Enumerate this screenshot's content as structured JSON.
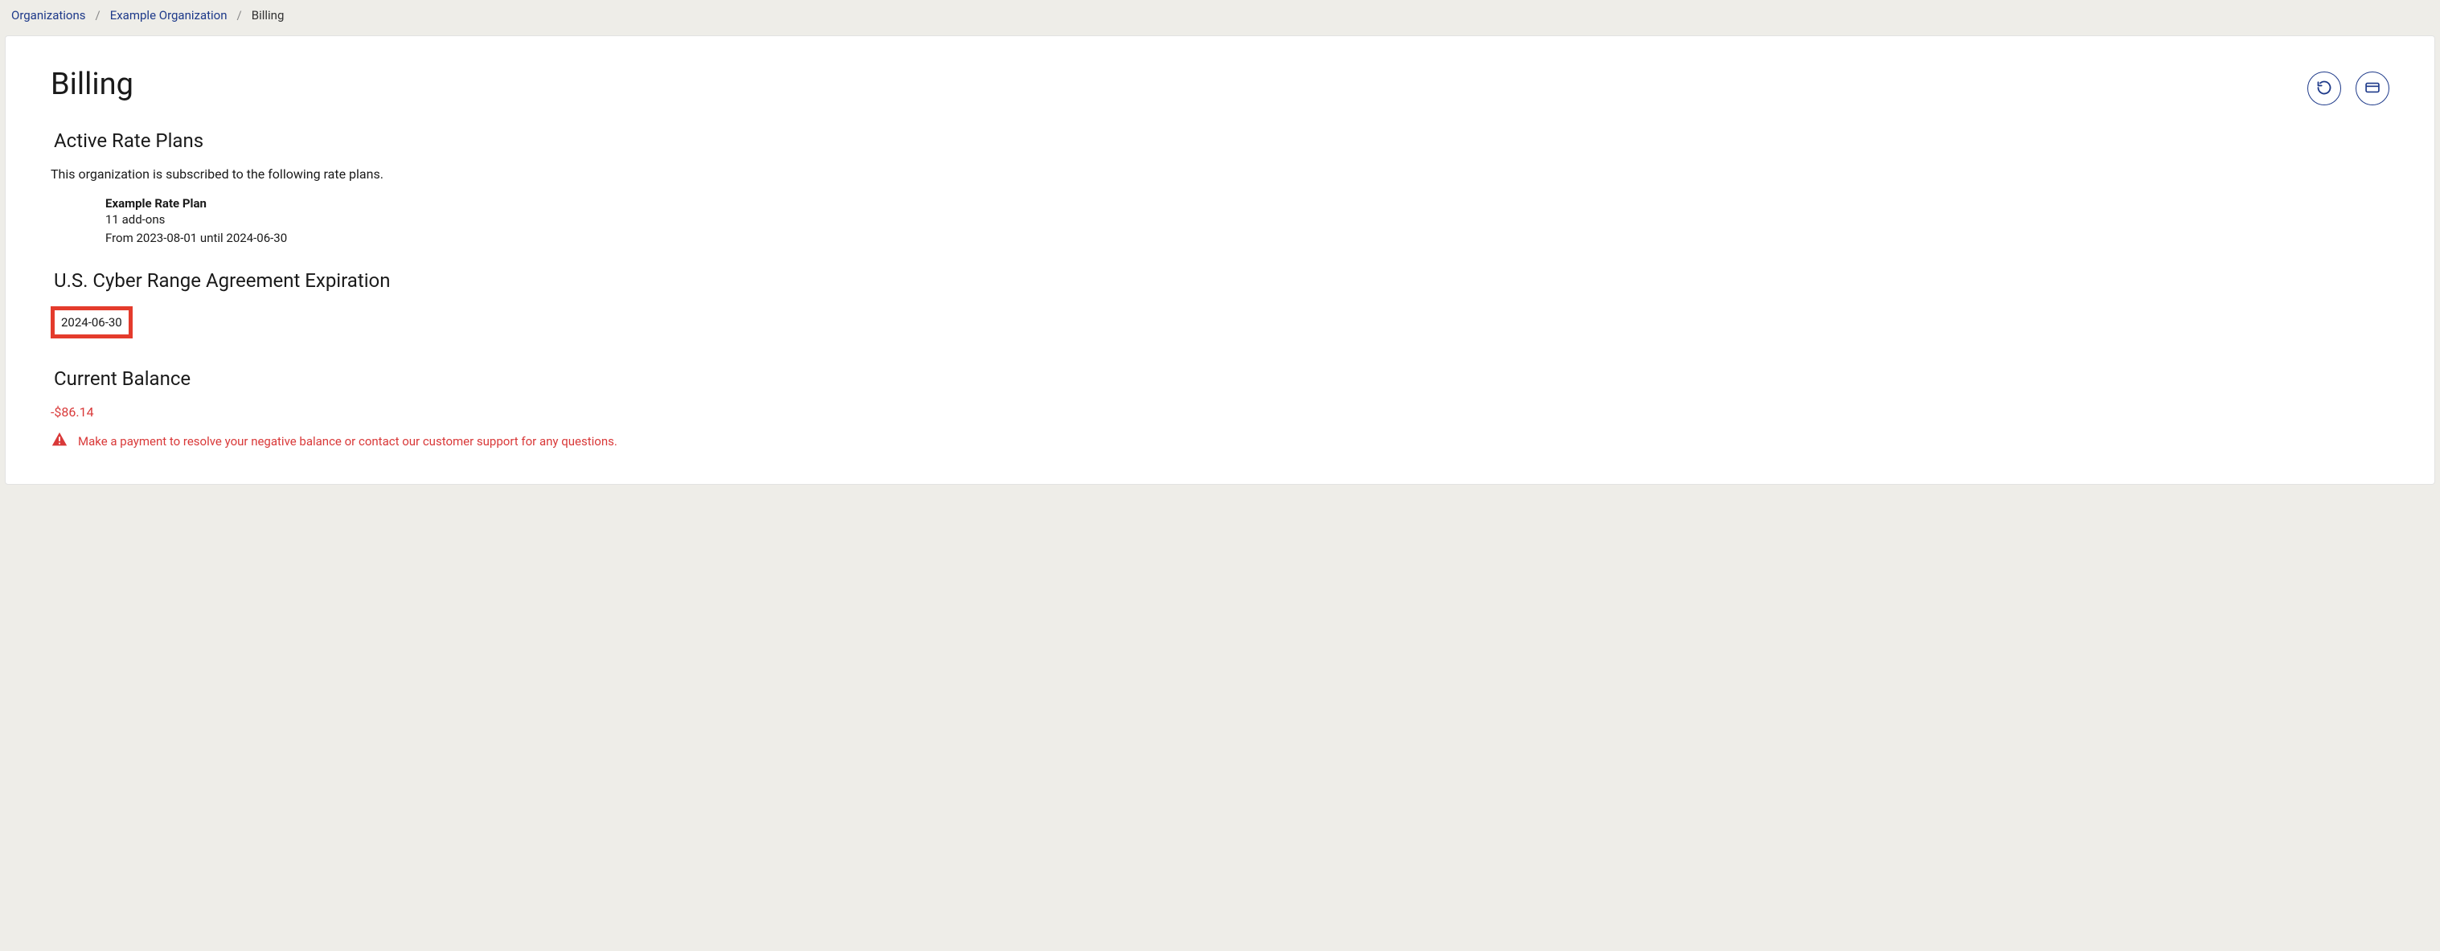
{
  "breadcrumb": {
    "root": "Organizations",
    "org": "Example Organization",
    "current": "Billing"
  },
  "page": {
    "title": "Billing"
  },
  "sections": {
    "active_plans": {
      "title": "Active Rate Plans",
      "intro": "This organization is subscribed to the following rate plans.",
      "plan": {
        "name": "Example Rate Plan",
        "addons": "11 add-ons",
        "period": "From 2023-08-01 until 2024-06-30"
      }
    },
    "agreement": {
      "title": "U.S. Cyber Range Agreement Expiration",
      "date": "2024-06-30"
    },
    "balance": {
      "title": "Current Balance",
      "amount": "-$86.14",
      "warning": "Make a payment to resolve your negative balance or contact our customer support for any questions."
    }
  }
}
